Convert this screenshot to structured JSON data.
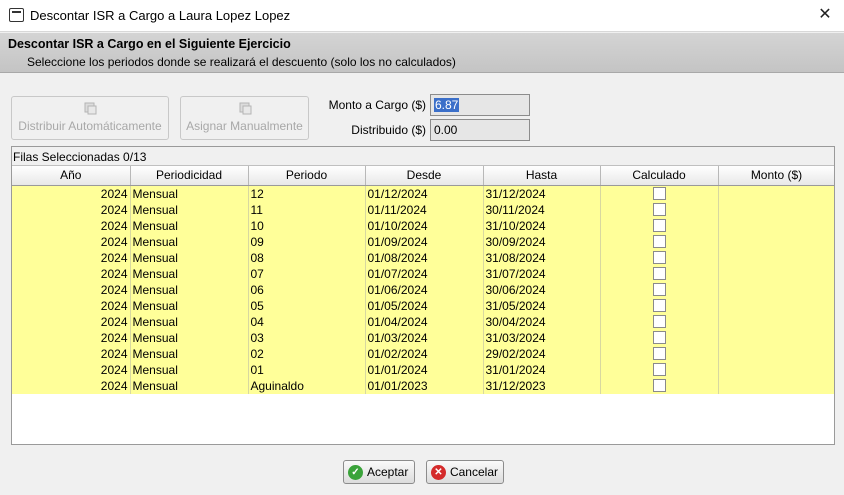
{
  "window": {
    "title": "Descontar ISR a Cargo a Laura Lopez Lopez",
    "close_glyph": "✕"
  },
  "header": {
    "title": "Descontar ISR a Cargo en el Siguiente Ejercicio",
    "subtitle": "Seleccione los periodos donde se realizará el descuento (solo los no calculados)"
  },
  "toolbar": {
    "auto_label": "Distribuir Automáticamente",
    "manual_label": "Asignar Manualmente"
  },
  "form": {
    "monto_label": "Monto a Cargo ($)",
    "monto_value": "6.87",
    "distribuido_label": "Distribuido ($)",
    "distribuido_value": "0.00"
  },
  "grid": {
    "info": "Filas Seleccionadas  0/13",
    "columns": [
      "Año",
      "Periodicidad",
      "Periodo",
      "Desde",
      "Hasta",
      "Calculado",
      "Monto ($)"
    ],
    "rows": [
      {
        "anio": "2024",
        "periodicidad": "Mensual",
        "periodo": "12",
        "desde": "01/12/2024",
        "hasta": "31/12/2024",
        "calculado": false,
        "monto": ""
      },
      {
        "anio": "2024",
        "periodicidad": "Mensual",
        "periodo": "11",
        "desde": "01/11/2024",
        "hasta": "30/11/2024",
        "calculado": false,
        "monto": ""
      },
      {
        "anio": "2024",
        "periodicidad": "Mensual",
        "periodo": "10",
        "desde": "01/10/2024",
        "hasta": "31/10/2024",
        "calculado": false,
        "monto": ""
      },
      {
        "anio": "2024",
        "periodicidad": "Mensual",
        "periodo": "09",
        "desde": "01/09/2024",
        "hasta": "30/09/2024",
        "calculado": false,
        "monto": ""
      },
      {
        "anio": "2024",
        "periodicidad": "Mensual",
        "periodo": "08",
        "desde": "01/08/2024",
        "hasta": "31/08/2024",
        "calculado": false,
        "monto": ""
      },
      {
        "anio": "2024",
        "periodicidad": "Mensual",
        "periodo": "07",
        "desde": "01/07/2024",
        "hasta": "31/07/2024",
        "calculado": false,
        "monto": ""
      },
      {
        "anio": "2024",
        "periodicidad": "Mensual",
        "periodo": "06",
        "desde": "01/06/2024",
        "hasta": "30/06/2024",
        "calculado": false,
        "monto": ""
      },
      {
        "anio": "2024",
        "periodicidad": "Mensual",
        "periodo": "05",
        "desde": "01/05/2024",
        "hasta": "31/05/2024",
        "calculado": false,
        "monto": ""
      },
      {
        "anio": "2024",
        "periodicidad": "Mensual",
        "periodo": "04",
        "desde": "01/04/2024",
        "hasta": "30/04/2024",
        "calculado": false,
        "monto": ""
      },
      {
        "anio": "2024",
        "periodicidad": "Mensual",
        "periodo": "03",
        "desde": "01/03/2024",
        "hasta": "31/03/2024",
        "calculado": false,
        "monto": ""
      },
      {
        "anio": "2024",
        "periodicidad": "Mensual",
        "periodo": "02",
        "desde": "01/02/2024",
        "hasta": "29/02/2024",
        "calculado": false,
        "monto": ""
      },
      {
        "anio": "2024",
        "periodicidad": "Mensual",
        "periodo": "01",
        "desde": "01/01/2024",
        "hasta": "31/01/2024",
        "calculado": false,
        "monto": ""
      },
      {
        "anio": "2024",
        "periodicidad": "Mensual",
        "periodo": "Aguinaldo",
        "desde": "01/01/2023",
        "hasta": "31/12/2023",
        "calculado": false,
        "monto": ""
      }
    ]
  },
  "buttons": {
    "accept_label": "Aceptar",
    "cancel_label": "Cancelar"
  },
  "colors": {
    "row_highlight": "#ffff99",
    "selection": "#3b6fc9",
    "accept_icon": "#3aa33a",
    "cancel_icon": "#d42a2a"
  },
  "icons": {
    "window": "window-icon",
    "auto_distribute": "distribute-icon",
    "manual_assign": "assign-icon",
    "accept": "check-circle-icon",
    "cancel": "x-circle-icon"
  }
}
